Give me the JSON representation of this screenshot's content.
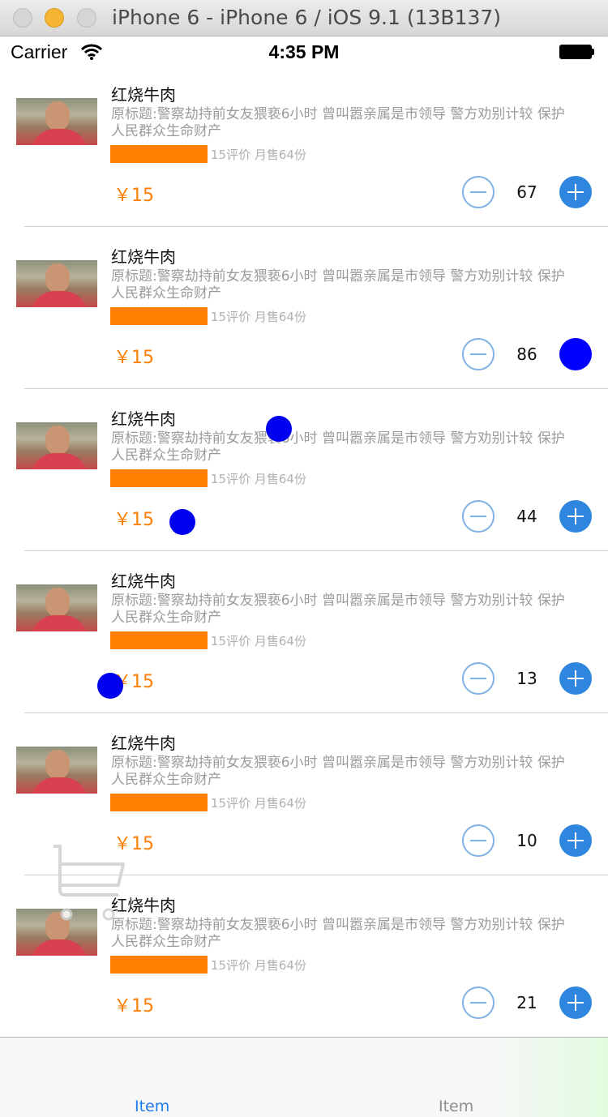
{
  "window": {
    "title": "iPhone 6 - iPhone 6 / iOS 9.1 (13B137)"
  },
  "status_bar": {
    "carrier": "Carrier",
    "time": "4:35 PM"
  },
  "items": [
    {
      "name": "红烧牛肉",
      "desc_line1": "原标题:警察劫持前女友猥亵6小时 曾叫嚣亲属是市领导 警方劝别计较 保护",
      "desc_line2": "人民群众生命财产",
      "meta": "15评价 月售64份",
      "price": "￥15",
      "quantity": "67"
    },
    {
      "name": "红烧牛肉",
      "desc_line1": "原标题:警察劫持前女友猥亵6小时 曾叫嚣亲属是市领导 警方劝别计较 保护",
      "desc_line2": "人民群众生命财产",
      "meta": "15评价 月售64份",
      "price": "￥15",
      "quantity": "86"
    },
    {
      "name": "红烧牛肉",
      "desc_line1": "原标题:警察劫持前女友猥亵6小时 曾叫嚣亲属是市领导 警方劝别计较 保护",
      "desc_line2": "人民群众生命财产",
      "meta": "15评价 月售64份",
      "price": "￥15",
      "quantity": "44"
    },
    {
      "name": "红烧牛肉",
      "desc_line1": "原标题:警察劫持前女友猥亵6小时 曾叫嚣亲属是市领导 警方劝别计较 保护",
      "desc_line2": "人民群众生命财产",
      "meta": "15评价 月售64份",
      "price": "￥15",
      "quantity": "13"
    },
    {
      "name": "红烧牛肉",
      "desc_line1": "原标题:警察劫持前女友猥亵6小时 曾叫嚣亲属是市领导 警方劝别计较 保护",
      "desc_line2": "人民群众生命财产",
      "meta": "15评价 月售64份",
      "price": "￥15",
      "quantity": "10"
    },
    {
      "name": "红烧牛肉",
      "desc_line1": "原标题:警察劫持前女友猥亵6小时 曾叫嚣亲属是市领导 警方劝别计较 保护",
      "desc_line2": "人民群众生命财产",
      "meta": "15评价 月售64份",
      "price": "￥15",
      "quantity": "21"
    }
  ],
  "tab_bar": {
    "tabs": [
      {
        "label": "Item",
        "selected": true
      },
      {
        "label": "Item",
        "selected": false
      }
    ]
  },
  "colors": {
    "accent": "#2f86de",
    "price": "#ff8000",
    "flying_dot": "#0000f0",
    "selected_tab": "#1e7cf0"
  }
}
